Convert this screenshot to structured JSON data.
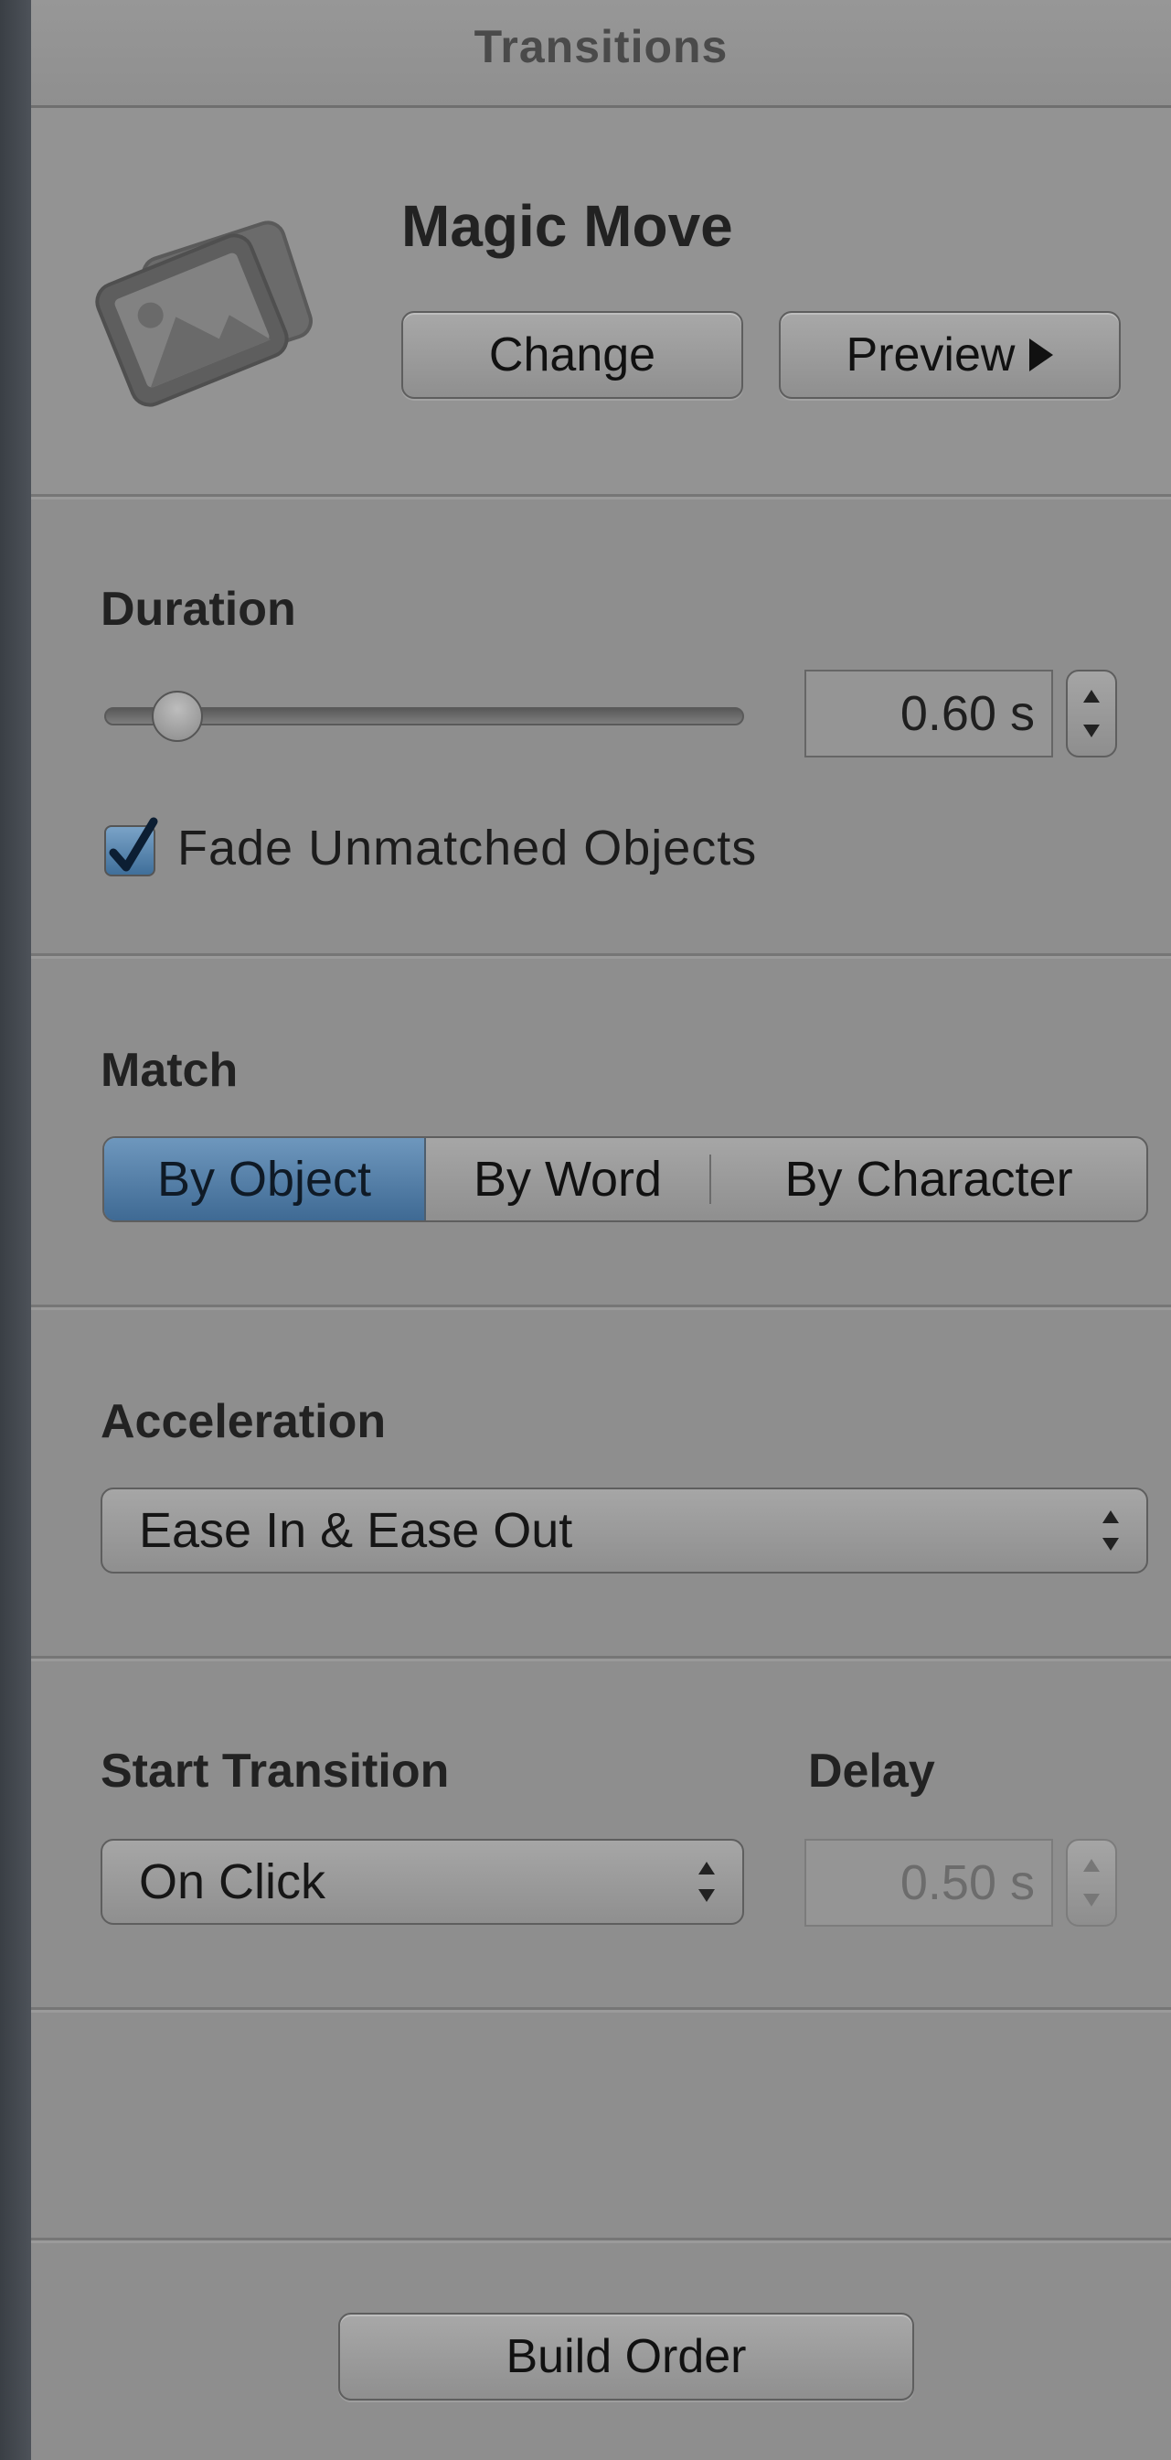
{
  "panel": {
    "title": "Transitions"
  },
  "transition": {
    "name": "Magic Move",
    "icon": "photo-stack-icon",
    "change_label": "Change",
    "preview_label": "Preview"
  },
  "duration": {
    "label": "Duration",
    "value": "0.60 s",
    "slider_fraction": 0.08,
    "fade_checkbox_label": "Fade Unmatched Objects",
    "fade_checked": true
  },
  "match": {
    "label": "Match",
    "options": [
      "By Object",
      "By Word",
      "By Character"
    ],
    "selected": "By Object"
  },
  "acceleration": {
    "label": "Acceleration",
    "value": "Ease In & Ease Out"
  },
  "start": {
    "label": "Start Transition",
    "value": "On Click",
    "delay_label": "Delay",
    "delay_value": "0.50 s"
  },
  "footer": {
    "build_order_label": "Build Order"
  },
  "colors": {
    "accent": "#4f7ba6",
    "panel": "#8e8e8e"
  }
}
